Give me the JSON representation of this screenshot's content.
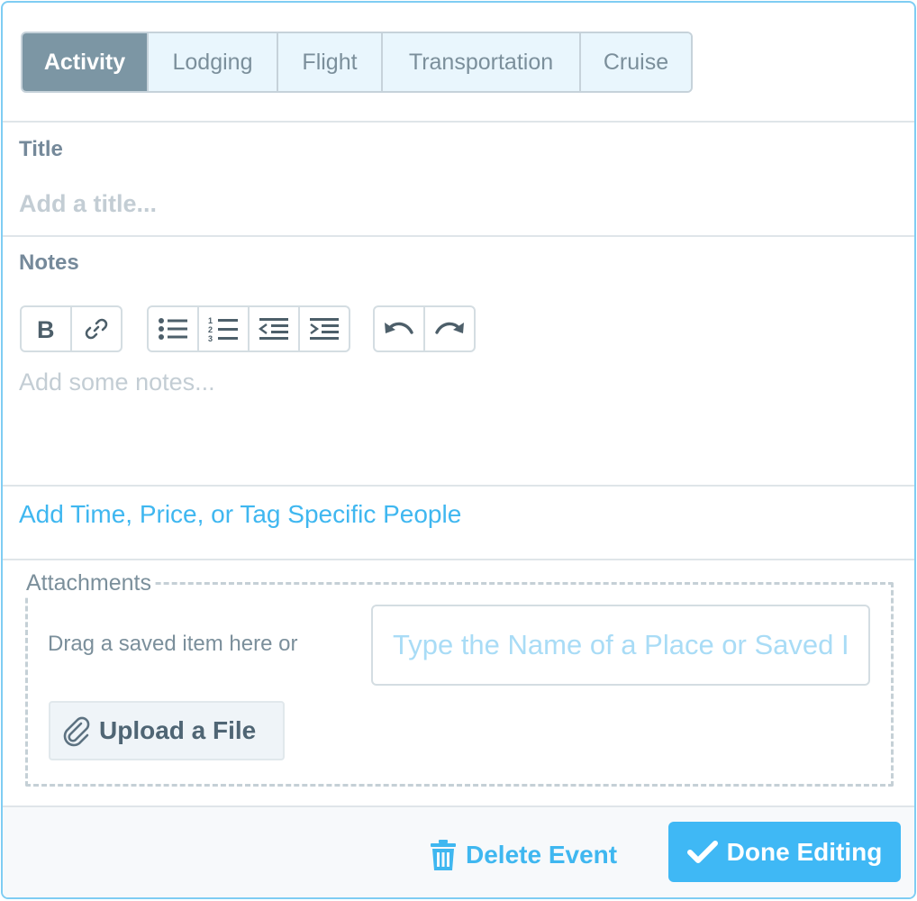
{
  "tabs": [
    {
      "label": "Activity",
      "active": true
    },
    {
      "label": "Lodging",
      "active": false
    },
    {
      "label": "Flight",
      "active": false
    },
    {
      "label": "Transportation",
      "active": false
    },
    {
      "label": "Cruise",
      "active": false
    }
  ],
  "title_section": {
    "label": "Title",
    "placeholder": "Add a title..."
  },
  "notes_section": {
    "label": "Notes",
    "placeholder": "Add some notes...",
    "toolbar_icons": [
      "bold-icon",
      "link-icon",
      "bulleted-list-icon",
      "numbered-list-icon",
      "outdent-icon",
      "indent-icon",
      "undo-icon",
      "redo-icon"
    ]
  },
  "add_details_link": "Add Time, Price, or Tag Specific People",
  "attachments": {
    "legend": "Attachments",
    "drag_text": "Drag a saved item here or",
    "search_placeholder": "Type the Name of a Place or Saved Item",
    "upload_label": "Upload a File",
    "upload_icon": "paperclip-icon"
  },
  "footer": {
    "delete_label": "Delete Event",
    "delete_icon": "trash-icon",
    "done_label": "Done Editing",
    "done_icon": "checkmark-icon"
  },
  "colors": {
    "accent": "#3fb8f5",
    "active_tab": "#7c96a4",
    "tab_bg": "#e9f6fd",
    "frame_border": "#7fcdf3"
  }
}
